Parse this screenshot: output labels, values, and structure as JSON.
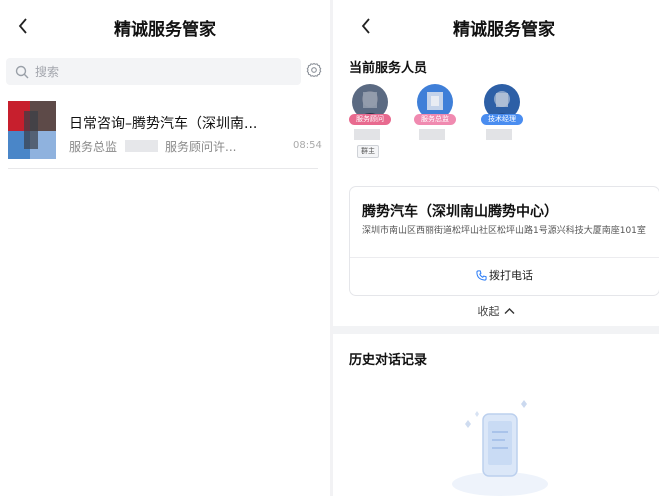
{
  "left": {
    "title": "精诚服务管家",
    "search_placeholder": "搜索",
    "conversation": {
      "title": "日常咨询–腾势汽车（深圳南...",
      "preview_a": "服务总监",
      "preview_b": "服务顾问许...",
      "time": "08:54"
    }
  },
  "right": {
    "title": "精诚服务管家",
    "staff_section_title": "当前服务人员",
    "staff": [
      {
        "role": "服务顾问",
        "color": "#e86a8f"
      },
      {
        "role": "服务总监",
        "color": "#f08ab0"
      },
      {
        "role": "技术经理",
        "color": "#4a8df0"
      }
    ],
    "owner_badge": "群主",
    "store": {
      "name": "腾势汽车（深圳南山腾势中心）",
      "address": "深圳市南山区西丽街道松坪山社区松坪山路1号源兴科技大厦南座101室",
      "call_label": "拨打电话"
    },
    "collapse_label": "收起",
    "history_title": "历史对话记录"
  },
  "colors": {
    "accent": "#2b7cf6",
    "divider": "#f2f2f4"
  },
  "icons": [
    "back-arrow-icon",
    "search-icon",
    "gear-icon",
    "phone-icon",
    "chevron-up-icon",
    "empty-phone-illustration"
  ]
}
